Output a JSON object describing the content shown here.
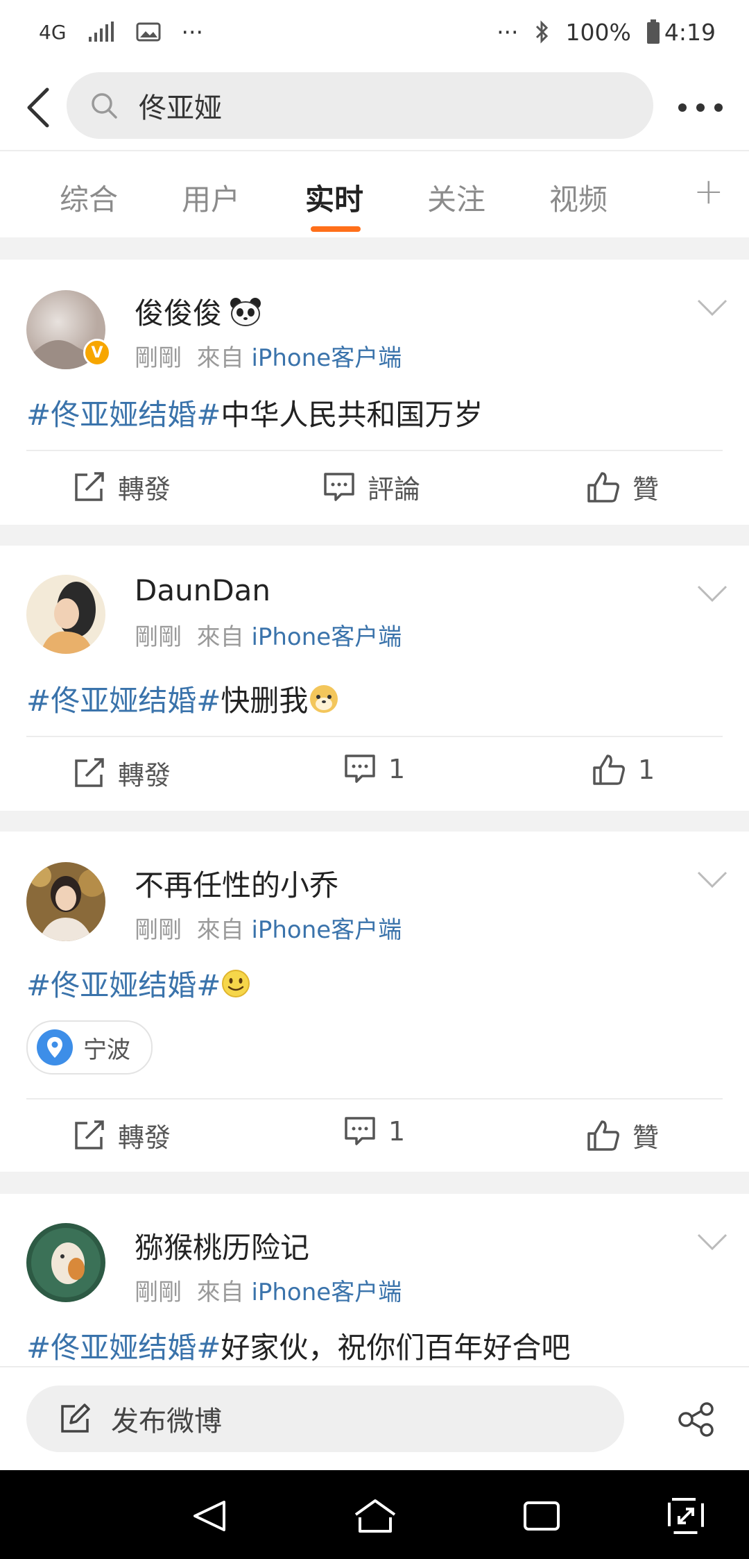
{
  "status_bar": {
    "network": "4G",
    "ellipsis_left": "···",
    "ellipsis_right": "···",
    "battery": "100%",
    "time": "4:19"
  },
  "search": {
    "query": "佟亚娅"
  },
  "tabs": [
    {
      "label": "综合",
      "active": false
    },
    {
      "label": "用户",
      "active": false
    },
    {
      "label": "实时",
      "active": true
    },
    {
      "label": "关注",
      "active": false
    },
    {
      "label": "视频",
      "active": false
    }
  ],
  "tab_add": "+",
  "posts": [
    {
      "username": "俊俊俊",
      "username_emoji": "panda",
      "verified": true,
      "time": "剛剛",
      "from": "來自",
      "source": "iPhone客户端",
      "hashtag": "#佟亚娅结婚#",
      "text": "中华人民共和国万岁",
      "repost": "轉發",
      "comment": "評論",
      "like": "贊"
    },
    {
      "username": "DaunDan",
      "time": "剛剛",
      "from": "來自",
      "source": "iPhone客户端",
      "hashtag": "#佟亚娅结婚#",
      "text": "快删我",
      "text_emoji": "doge",
      "repost": "轉發",
      "comment": "1",
      "like": "1"
    },
    {
      "username": "不再任性的小乔",
      "time": "剛剛",
      "from": "來自",
      "source": "iPhone客户端",
      "hashtag": "#佟亚娅结婚#",
      "text": "",
      "text_emoji": "smile",
      "location": "宁波",
      "repost": "轉發",
      "comment": "1",
      "like": "贊"
    },
    {
      "username": "猕猴桃历险记",
      "time": "剛剛",
      "from": "來自",
      "source": "iPhone客户端",
      "hashtag": "#佟亚娅结婚#",
      "text": "好家伙，祝你们百年好合吧"
    }
  ],
  "compose": {
    "placeholder": "发布微博"
  },
  "colors": {
    "accent": "#ff6f1a",
    "link": "#3a73ab",
    "verified": "#f7a600",
    "location": "#3d8ee8"
  }
}
